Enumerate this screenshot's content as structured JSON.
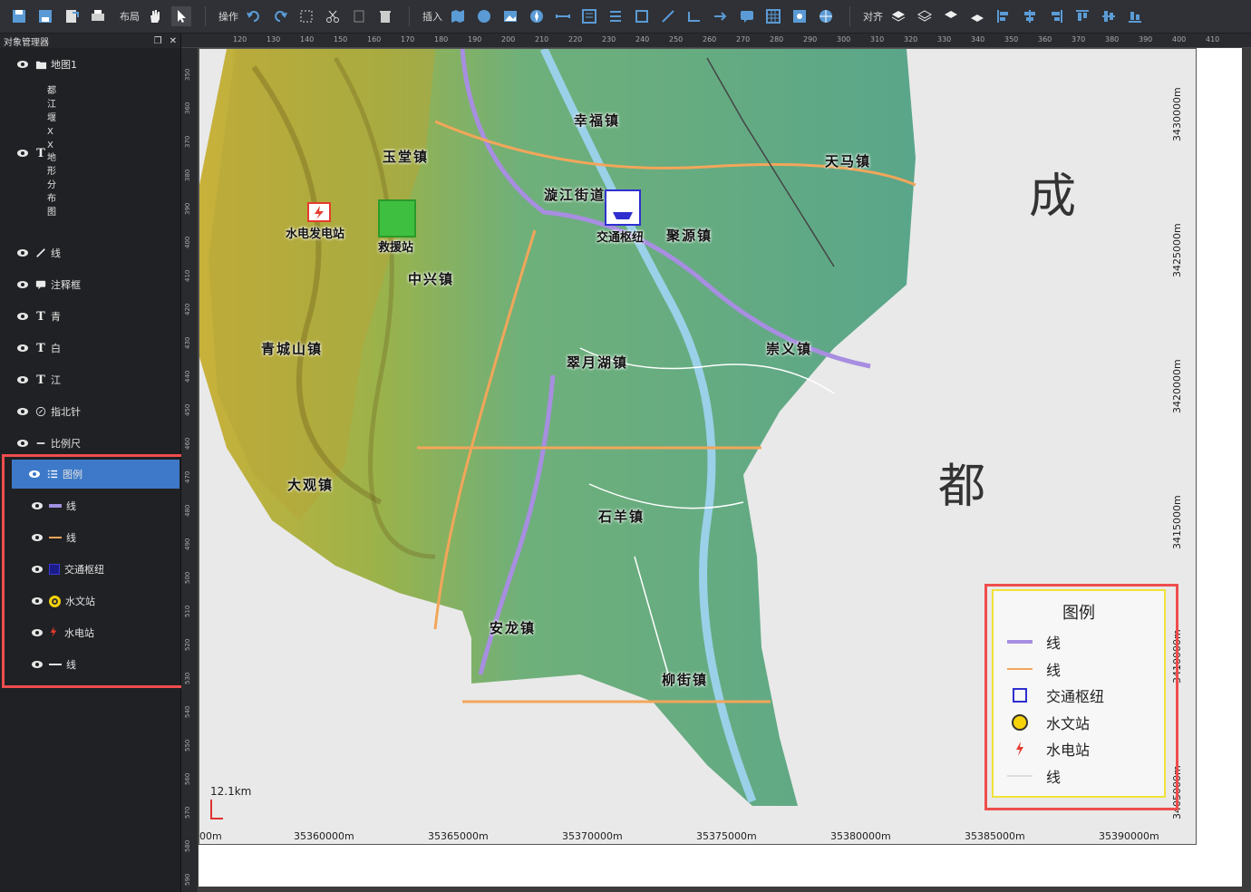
{
  "toolbar": {
    "layout_label": "布局",
    "operate_label": "操作",
    "insert_label": "插入",
    "align_label": "对齐"
  },
  "panel": {
    "title": "对象管理器",
    "map_label": "地图1",
    "vertical_text_1": [
      "都",
      "江",
      "堰",
      "X",
      "X"
    ],
    "text_layer_label_chars": [
      "地",
      "形",
      "分",
      "布",
      "图"
    ],
    "items": [
      {
        "label": "线"
      },
      {
        "label": "注释框"
      },
      {
        "label": "青"
      },
      {
        "label": "白"
      },
      {
        "label": "江"
      },
      {
        "label": "指北针"
      },
      {
        "label": "比例尺"
      },
      {
        "label": "图例"
      }
    ],
    "legend_children": [
      {
        "label": "线"
      },
      {
        "label": "线"
      },
      {
        "label": "交通枢纽"
      },
      {
        "label": "水文站"
      },
      {
        "label": "水电站"
      },
      {
        "label": "线"
      }
    ]
  },
  "hruler_ticks": [
    "120",
    "130",
    "140",
    "150",
    "160",
    "170",
    "180",
    "190",
    "200",
    "210",
    "220",
    "230",
    "240",
    "250",
    "260",
    "270",
    "280",
    "290",
    "300",
    "310",
    "320",
    "330",
    "340",
    "350",
    "360",
    "370",
    "380",
    "390",
    "400",
    "410"
  ],
  "vruler_ticks": [
    "350",
    "360",
    "370",
    "380",
    "390",
    "400",
    "410",
    "420",
    "430",
    "440",
    "450",
    "460",
    "470",
    "480",
    "490",
    "500",
    "510",
    "520",
    "530",
    "540",
    "550",
    "560",
    "570",
    "580",
    "590"
  ],
  "map": {
    "x_coords": [
      "00m",
      "35360000m",
      "35365000m",
      "35370000m",
      "35375000m",
      "35380000m",
      "35385000m",
      "35390000m"
    ],
    "y_coords": [
      "3430000m",
      "3425000m",
      "3420000m",
      "3415000m",
      "3410000m",
      "3405000m"
    ],
    "scale_label": "12.1km",
    "big_chars": [
      "成",
      "都"
    ],
    "places": [
      "玉堂镇",
      "幸福镇",
      "天马镇",
      "漩江街道",
      "聚源镇",
      "中兴镇",
      "青城山镇",
      "翠月湖镇",
      "崇义镇",
      "大观镇",
      "石羊镇",
      "安龙镇",
      "柳街镇"
    ],
    "poi_labels": [
      "水电发电站",
      "救援站",
      "交通枢纽"
    ]
  },
  "legend": {
    "title": "图例",
    "entries": [
      "线",
      "线",
      "交通枢纽",
      "水文站",
      "水电站",
      "线"
    ]
  }
}
